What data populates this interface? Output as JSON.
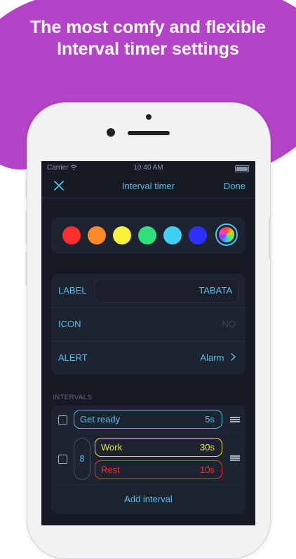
{
  "headline": "The most comfy and flexible Interval timer settings",
  "status_bar": {
    "carrier": "Carrier",
    "time": "10:40 AM"
  },
  "nav": {
    "title": "Interval timer",
    "done_label": "Done",
    "close_icon": "close-icon"
  },
  "colors": [
    {
      "name": "red",
      "hex": "#ff2d2d"
    },
    {
      "name": "orange",
      "hex": "#ff8a2a"
    },
    {
      "name": "yellow",
      "hex": "#f8f03a"
    },
    {
      "name": "green",
      "hex": "#2fe07a"
    },
    {
      "name": "cyan",
      "hex": "#3fd0f5"
    },
    {
      "name": "blue",
      "hex": "#2f2fff"
    }
  ],
  "settings": {
    "label": {
      "title": "LABEL",
      "value": "TABATA"
    },
    "icon": {
      "title": "ICON",
      "value": "NO"
    },
    "alert": {
      "title": "ALERT",
      "value": "Alarm"
    }
  },
  "intervals": {
    "section_title": "INTERVALS",
    "get_ready": {
      "name": "Get ready",
      "duration": "5s",
      "color": "#3fc3e8"
    },
    "repeat_count": "8",
    "work": {
      "name": "Work",
      "duration": "30s",
      "color": "#f0e03a"
    },
    "rest": {
      "name": "Rest",
      "duration": "10s",
      "color": "#f03030"
    },
    "add_label": "Add interval"
  },
  "theme": {
    "accent": "#4fc3e8",
    "background": "#151a24",
    "brand_purple": "#b543c7"
  }
}
